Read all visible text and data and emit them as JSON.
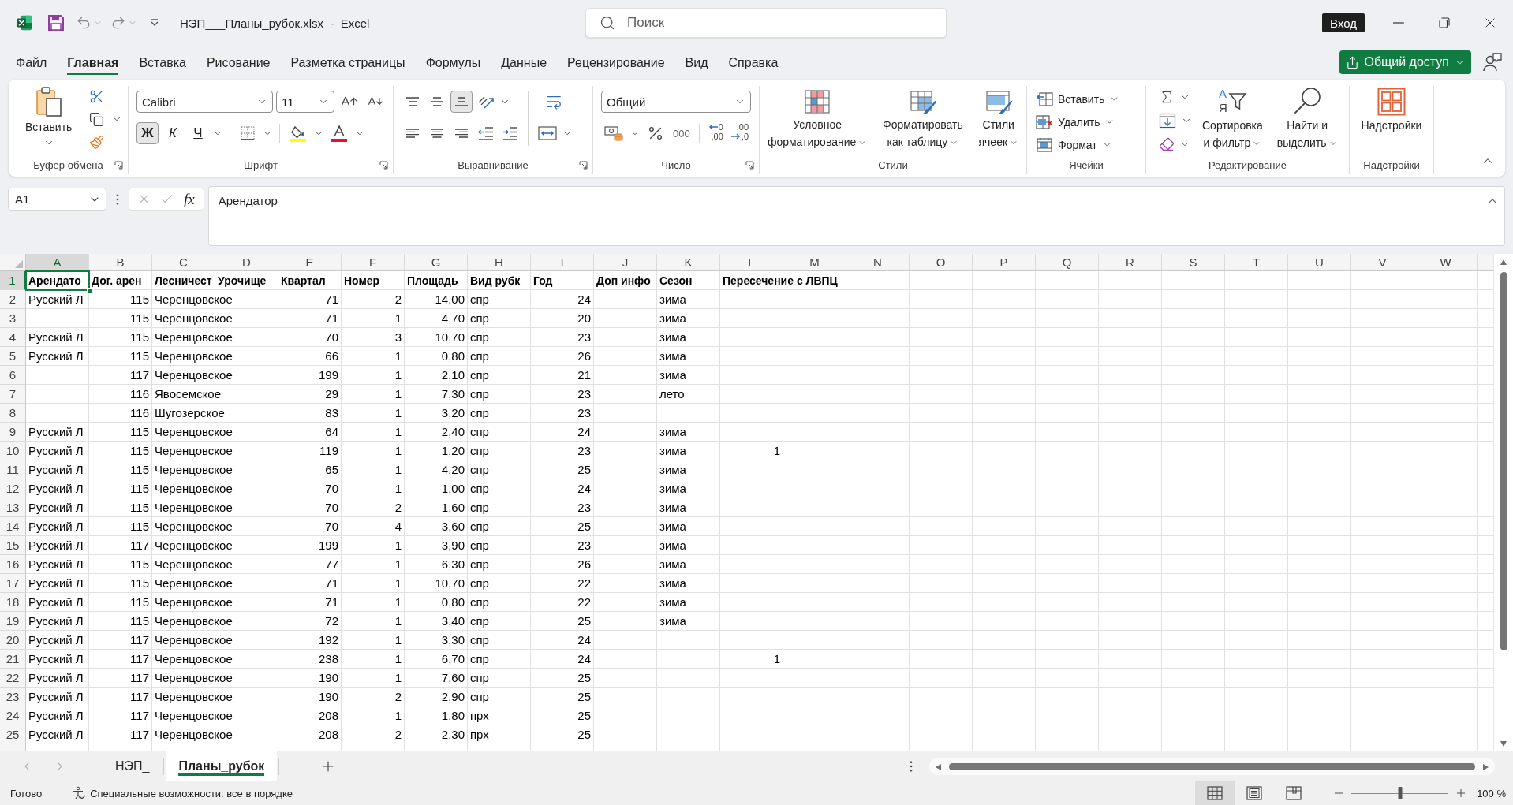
{
  "title_bar": {
    "title": "НЭП___Планы_рубок.xlsx  -  Excel",
    "search": {
      "placeholder": "Поиск"
    },
    "sign_in": "Вход"
  },
  "tabs": [
    {
      "label": "Файл",
      "selected": false
    },
    {
      "label": "Главная",
      "selected": true
    },
    {
      "label": "Вставка",
      "selected": false
    },
    {
      "label": "Рисование",
      "selected": false
    },
    {
      "label": "Разметка страницы",
      "selected": false
    },
    {
      "label": "Формулы",
      "selected": false
    },
    {
      "label": "Данные",
      "selected": false
    },
    {
      "label": "Рецензирование",
      "selected": false
    },
    {
      "label": "Вид",
      "selected": false
    },
    {
      "label": "Справка",
      "selected": false
    }
  ],
  "share_button": "Общий доступ",
  "ribbon": {
    "clipboard": {
      "label": "Буфер обмена",
      "paste": "Вставить"
    },
    "font": {
      "label": "Шрифт",
      "font_name": "Calibri",
      "font_size": "11",
      "bold": {
        "label": "Ж",
        "on": true
      },
      "italic": {
        "label": "К",
        "on": false
      },
      "underline": {
        "label": "Ч",
        "on": false
      }
    },
    "alignment": {
      "label": "Выравнивание",
      "vertical": [
        {
          "kind": "top",
          "on": false
        },
        {
          "kind": "middle",
          "on": false
        },
        {
          "kind": "bottom",
          "on": true
        }
      ],
      "horizontal": [
        {
          "kind": "left",
          "on": false
        },
        {
          "kind": "center",
          "on": false
        },
        {
          "kind": "right",
          "on": false
        }
      ]
    },
    "number": {
      "label": "Число",
      "format": "Общий",
      "comma_style": "000",
      "increase_decimal": [
        "0",
        ",00"
      ],
      "decrease_decimal": [
        ",00",
        ",0"
      ]
    },
    "styles": {
      "label": "Стили",
      "buttons": [
        {
          "kind": "conditional",
          "lines": [
            "Условное",
            "форматирование"
          ]
        },
        {
          "kind": "table",
          "lines": [
            "Форматировать",
            "как таблицу"
          ]
        },
        {
          "kind": "cell_styles",
          "lines": [
            "Стили",
            "ячеек"
          ]
        }
      ]
    },
    "cells": {
      "label": "Ячейки",
      "buttons": [
        {
          "kind": "insert",
          "label": "Вставить"
        },
        {
          "kind": "delete",
          "label": "Удалить"
        },
        {
          "kind": "format",
          "label": "Формат"
        }
      ]
    },
    "editing": {
      "label": "Редактирование",
      "sort": {
        "icon_letters": [
          "А",
          "Я"
        ],
        "lines": [
          "Сортировка",
          "и фильтр"
        ]
      },
      "find": {
        "lines": [
          "Найти и",
          "выделить"
        ]
      }
    },
    "addins": {
      "label": "Надстройки",
      "button": "Надстройки"
    }
  },
  "formula_bar": {
    "name_box": "A1",
    "function_button": "fx",
    "formula": "Арендатор"
  },
  "sheet": {
    "columns": [
      {
        "label": "A",
        "selected": true
      },
      {
        "label": "B",
        "selected": false
      },
      {
        "label": "C",
        "selected": false
      },
      {
        "label": "D",
        "selected": false
      },
      {
        "label": "E",
        "selected": false
      },
      {
        "label": "F",
        "selected": false
      },
      {
        "label": "G",
        "selected": false
      },
      {
        "label": "H",
        "selected": false
      },
      {
        "label": "I",
        "selected": false
      },
      {
        "label": "J",
        "selected": false
      },
      {
        "label": "K",
        "selected": false
      },
      {
        "label": "L",
        "selected": false
      },
      {
        "label": "M",
        "selected": false
      },
      {
        "label": "N",
        "selected": false
      },
      {
        "label": "O",
        "selected": false
      },
      {
        "label": "P",
        "selected": false
      },
      {
        "label": "Q",
        "selected": false
      },
      {
        "label": "R",
        "selected": false
      },
      {
        "label": "S",
        "selected": false
      },
      {
        "label": "T",
        "selected": false
      },
      {
        "label": "U",
        "selected": false
      },
      {
        "label": "V",
        "selected": false
      },
      {
        "label": "W",
        "selected": false
      }
    ],
    "rows": [
      {
        "number": "1",
        "selected": true,
        "kind": "header",
        "text": {
          "A": "Арендато",
          "B": "Дог. арен",
          "C": "Лесничест",
          "D": "Урочище",
          "E": "Квартал",
          "F": "Номер",
          "G": "Площадь",
          "H": "Вид рубк",
          "I": "Год",
          "J": "Доп инфо",
          "K": "Сезон",
          "L": "Пересечение с ЛВПЦ"
        }
      },
      {
        "number": "2",
        "selected": false,
        "kind": "data",
        "text": {
          "A": "Русский Л",
          "C": "Черенцовское",
          "H": "спр",
          "K": "зима"
        },
        "numbers": {
          "B": "115",
          "E": "71",
          "F": "2",
          "G": "14,00",
          "I": "24"
        }
      },
      {
        "number": "3",
        "selected": false,
        "kind": "data",
        "text": {
          "C": "Черенцовское",
          "H": "спр",
          "K": "зима"
        },
        "numbers": {
          "B": "115",
          "E": "71",
          "F": "1",
          "G": "4,70",
          "I": "20"
        }
      },
      {
        "number": "4",
        "selected": false,
        "kind": "data",
        "text": {
          "A": "Русский Л",
          "C": "Черенцовское",
          "H": "спр",
          "K": "зима"
        },
        "numbers": {
          "B": "115",
          "E": "70",
          "F": "3",
          "G": "10,70",
          "I": "23"
        }
      },
      {
        "number": "5",
        "selected": false,
        "kind": "data",
        "text": {
          "A": "Русский Л",
          "C": "Черенцовское",
          "H": "спр",
          "K": "зима"
        },
        "numbers": {
          "B": "115",
          "E": "66",
          "F": "1",
          "G": "0,80",
          "I": "26"
        }
      },
      {
        "number": "6",
        "selected": false,
        "kind": "data",
        "text": {
          "C": "Черенцовское",
          "H": "спр",
          "K": "зима"
        },
        "numbers": {
          "B": "117",
          "E": "199",
          "F": "1",
          "G": "2,10",
          "I": "21"
        }
      },
      {
        "number": "7",
        "selected": false,
        "kind": "data",
        "text": {
          "C": "Явосемское",
          "H": "спр",
          "K": "лето"
        },
        "numbers": {
          "B": "116",
          "E": "29",
          "F": "1",
          "G": "7,30",
          "I": "23"
        }
      },
      {
        "number": "8",
        "selected": false,
        "kind": "data",
        "text": {
          "C": "Шугозерское",
          "H": "спр"
        },
        "numbers": {
          "B": "116",
          "E": "83",
          "F": "1",
          "G": "3,20",
          "I": "23"
        }
      },
      {
        "number": "9",
        "selected": false,
        "kind": "data",
        "text": {
          "A": "Русский Л",
          "C": "Черенцовское",
          "H": "спр",
          "K": "зима"
        },
        "numbers": {
          "B": "115",
          "E": "64",
          "F": "1",
          "G": "2,40",
          "I": "24"
        }
      },
      {
        "number": "10",
        "selected": false,
        "kind": "data",
        "text": {
          "A": "Русский Л",
          "C": "Черенцовское",
          "H": "спр",
          "K": "зима"
        },
        "numbers": {
          "B": "115",
          "E": "119",
          "F": "1",
          "G": "1,20",
          "I": "23",
          "L": "1"
        }
      },
      {
        "number": "11",
        "selected": false,
        "kind": "data",
        "text": {
          "A": "Русский Л",
          "C": "Черенцовское",
          "H": "спр",
          "K": "зима"
        },
        "numbers": {
          "B": "115",
          "E": "65",
          "F": "1",
          "G": "4,20",
          "I": "25"
        }
      },
      {
        "number": "12",
        "selected": false,
        "kind": "data",
        "text": {
          "A": "Русский Л",
          "C": "Черенцовское",
          "H": "спр",
          "K": "зима"
        },
        "numbers": {
          "B": "115",
          "E": "70",
          "F": "1",
          "G": "1,00",
          "I": "24"
        }
      },
      {
        "number": "13",
        "selected": false,
        "kind": "data",
        "text": {
          "A": "Русский Л",
          "C": "Черенцовское",
          "H": "спр",
          "K": "зима"
        },
        "numbers": {
          "B": "115",
          "E": "70",
          "F": "2",
          "G": "1,60",
          "I": "23"
        }
      },
      {
        "number": "14",
        "selected": false,
        "kind": "data",
        "text": {
          "A": "Русский Л",
          "C": "Черенцовское",
          "H": "спр",
          "K": "зима"
        },
        "numbers": {
          "B": "115",
          "E": "70",
          "F": "4",
          "G": "3,60",
          "I": "25"
        }
      },
      {
        "number": "15",
        "selected": false,
        "kind": "data",
        "text": {
          "A": "Русский Л",
          "C": "Черенцовское",
          "H": "спр",
          "K": "зима"
        },
        "numbers": {
          "B": "117",
          "E": "199",
          "F": "1",
          "G": "3,90",
          "I": "23"
        }
      },
      {
        "number": "16",
        "selected": false,
        "kind": "data",
        "text": {
          "A": "Русский Л",
          "C": "Черенцовское",
          "H": "спр",
          "K": "зима"
        },
        "numbers": {
          "B": "115",
          "E": "77",
          "F": "1",
          "G": "6,30",
          "I": "26"
        }
      },
      {
        "number": "17",
        "selected": false,
        "kind": "data",
        "text": {
          "A": "Русский Л",
          "C": "Черенцовское",
          "H": "спр",
          "K": "зима"
        },
        "numbers": {
          "B": "115",
          "E": "71",
          "F": "1",
          "G": "10,70",
          "I": "22"
        }
      },
      {
        "number": "18",
        "selected": false,
        "kind": "data",
        "text": {
          "A": "Русский Л",
          "C": "Черенцовское",
          "H": "спр",
          "K": "зима"
        },
        "numbers": {
          "B": "115",
          "E": "71",
          "F": "1",
          "G": "0,80",
          "I": "22"
        }
      },
      {
        "number": "19",
        "selected": false,
        "kind": "data",
        "text": {
          "A": "Русский Л",
          "C": "Черенцовское",
          "H": "спр",
          "K": "зима"
        },
        "numbers": {
          "B": "115",
          "E": "72",
          "F": "1",
          "G": "3,40",
          "I": "25"
        }
      },
      {
        "number": "20",
        "selected": false,
        "kind": "data",
        "text": {
          "A": "Русский Л",
          "C": "Черенцовское",
          "H": "спр"
        },
        "numbers": {
          "B": "117",
          "E": "192",
          "F": "1",
          "G": "3,30",
          "I": "24"
        }
      },
      {
        "number": "21",
        "selected": false,
        "kind": "data",
        "text": {
          "A": "Русский Л",
          "C": "Черенцовское",
          "H": "спр"
        },
        "numbers": {
          "B": "117",
          "E": "238",
          "F": "1",
          "G": "6,70",
          "I": "24",
          "L": "1"
        }
      },
      {
        "number": "22",
        "selected": false,
        "kind": "data",
        "text": {
          "A": "Русский Л",
          "C": "Черенцовское",
          "H": "спр"
        },
        "numbers": {
          "B": "117",
          "E": "190",
          "F": "1",
          "G": "7,60",
          "I": "25"
        }
      },
      {
        "number": "23",
        "selected": false,
        "kind": "data",
        "text": {
          "A": "Русский Л",
          "C": "Черенцовское",
          "H": "спр"
        },
        "numbers": {
          "B": "117",
          "E": "190",
          "F": "2",
          "G": "2,90",
          "I": "25"
        }
      },
      {
        "number": "24",
        "selected": false,
        "kind": "data",
        "text": {
          "A": "Русский Л",
          "C": "Черенцовское",
          "H": "прх"
        },
        "numbers": {
          "B": "117",
          "E": "208",
          "F": "1",
          "G": "1,80",
          "I": "25"
        }
      },
      {
        "number": "25",
        "selected": false,
        "kind": "data",
        "text": {
          "A": "Русский Л",
          "C": "Черенцовское",
          "H": "прх"
        },
        "numbers": {
          "B": "117",
          "E": "208",
          "F": "2",
          "G": "2,30",
          "I": "25"
        }
      }
    ]
  },
  "sheet_tabs": [
    {
      "label": "НЭП_",
      "selected": false
    },
    {
      "label": "Планы_рубок",
      "selected": true
    }
  ],
  "status_bar": {
    "status": "Готово",
    "accessibility": "Специальные возможности: все в порядке",
    "views": [
      {
        "kind": "normal",
        "selected": true
      },
      {
        "kind": "page_layout",
        "selected": false
      },
      {
        "kind": "page_break",
        "selected": false
      }
    ],
    "zoom": {
      "level": 0.5,
      "reading": "100 %"
    }
  }
}
